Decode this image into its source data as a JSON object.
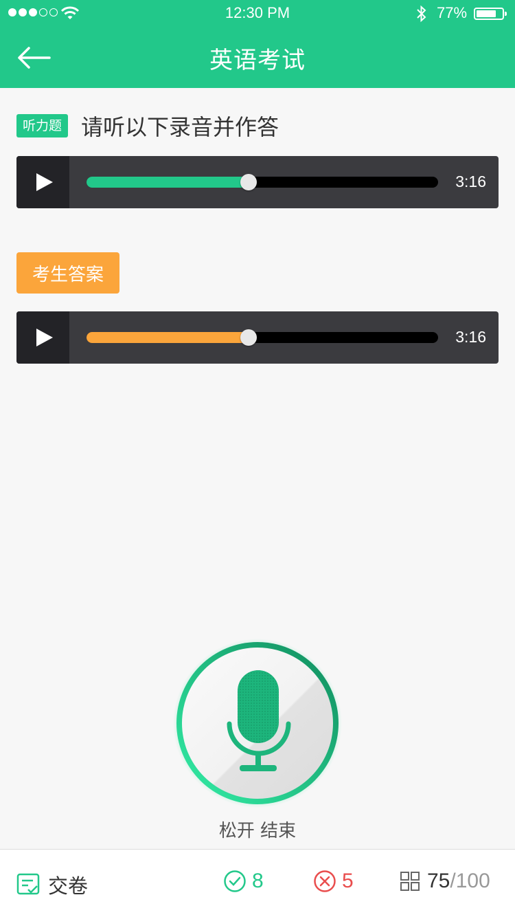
{
  "status_bar": {
    "time": "12:30 PM",
    "battery_text": "77%",
    "battery_level": 0.77,
    "signal_bars_filled": 3,
    "signal_bars_total": 5
  },
  "nav": {
    "title": "英语考试",
    "back_icon": "arrow-left-icon"
  },
  "question": {
    "tag": "听力题",
    "text": "请听以下录音并作答"
  },
  "listening_player": {
    "duration": "3:16",
    "progress": 0.46,
    "color": "#22c88a"
  },
  "answer_section": {
    "tag": "考生答案"
  },
  "answer_player": {
    "duration": "3:16",
    "progress": 0.46,
    "color": "#fba53b"
  },
  "microphone": {
    "icon": "microphone-icon",
    "caption": "松开 结束"
  },
  "bottom_bar": {
    "submit_label": "交卷",
    "correct_count": "8",
    "wrong_count": "5",
    "current": "75",
    "total": "/100"
  },
  "colors": {
    "brand": "#22c88a",
    "accent": "#fba53b",
    "error": "#e94d4d"
  }
}
